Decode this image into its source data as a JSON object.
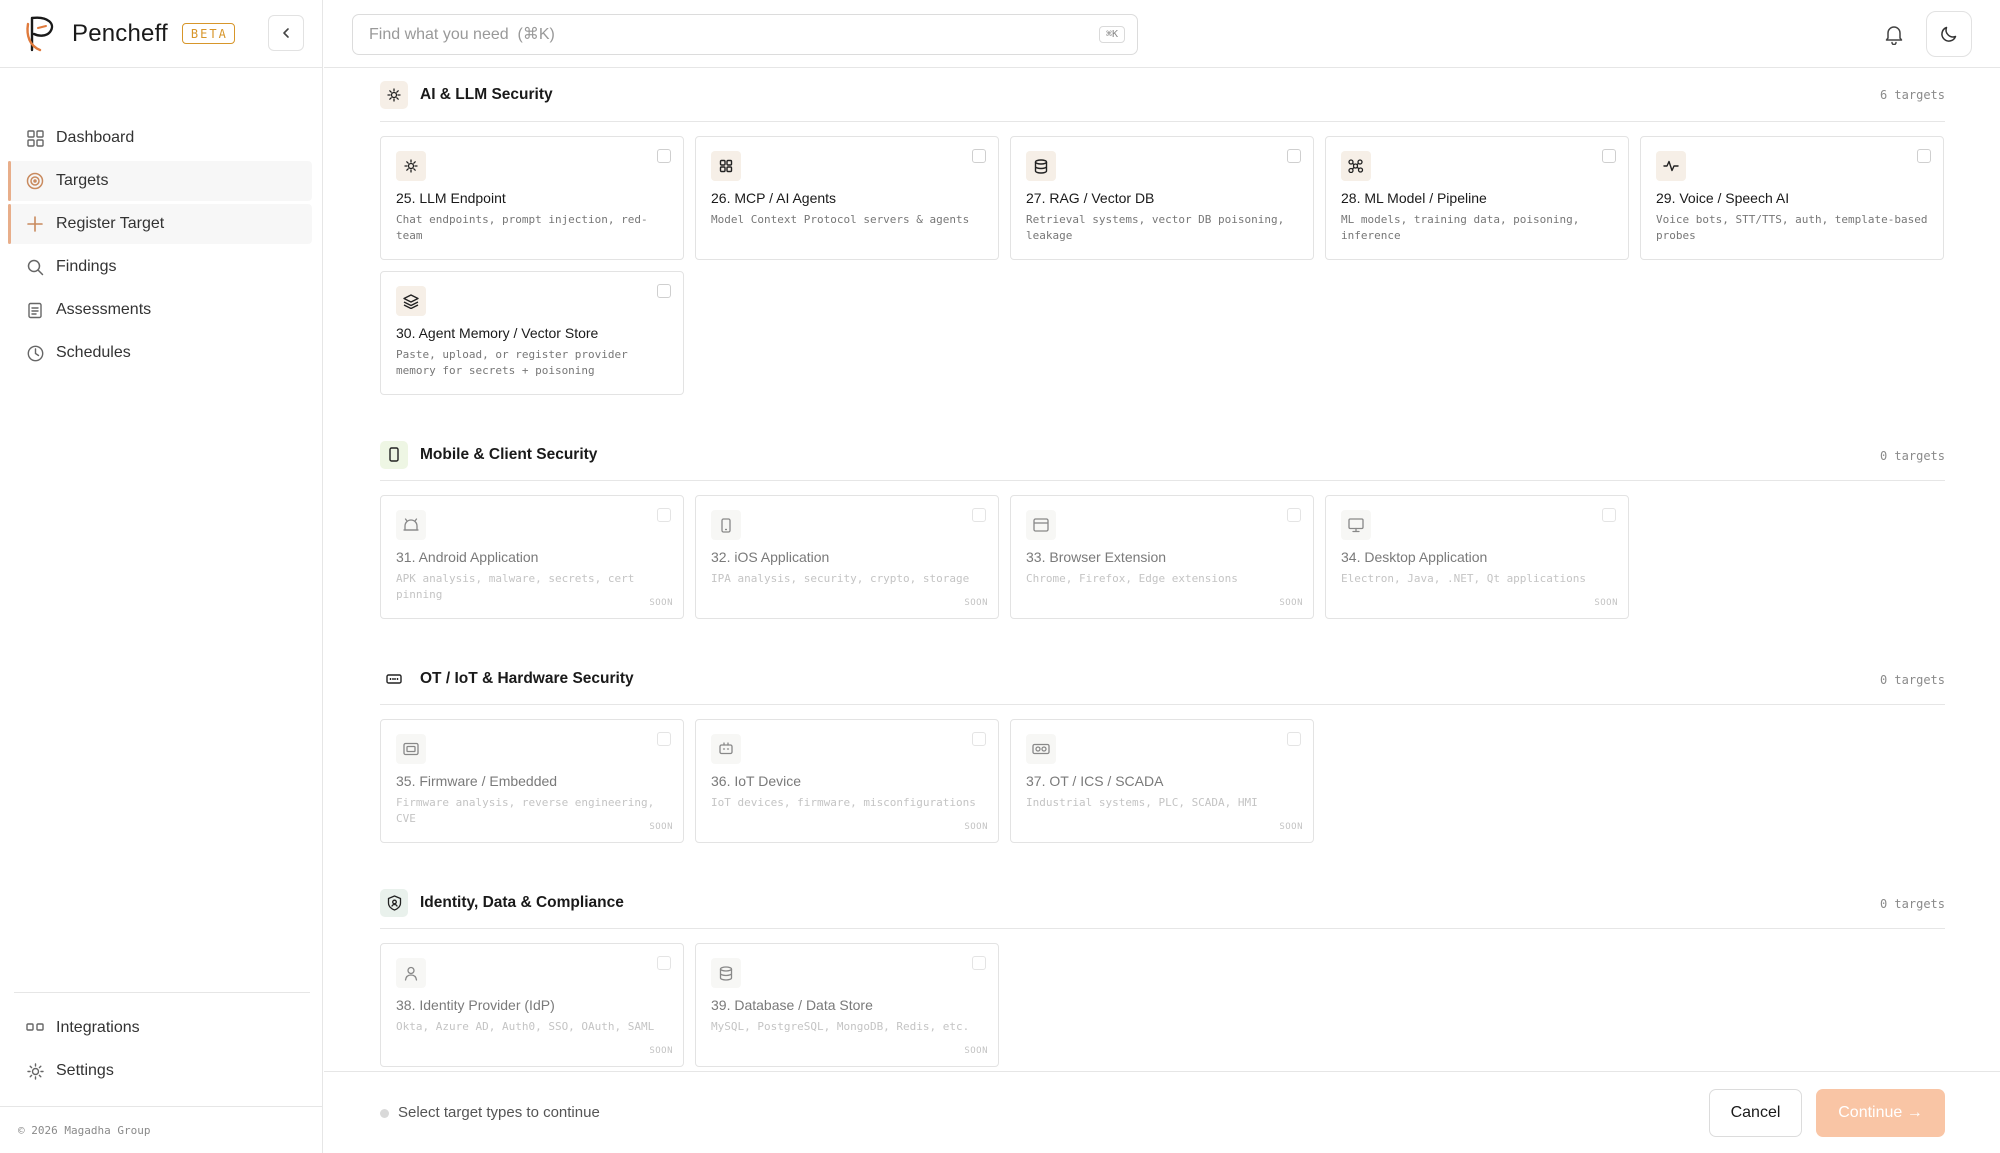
{
  "brand": {
    "name": "Pencheff",
    "badge": "BETA"
  },
  "search": {
    "placeholder": "Find what you need  (⌘K)",
    "shortcut": "⌘K"
  },
  "sidebar": {
    "items": [
      {
        "label": "Dashboard",
        "icon": "grid-icon"
      },
      {
        "label": "Targets",
        "icon": "target-icon"
      },
      {
        "label": "Register Target",
        "icon": "plus-icon"
      },
      {
        "label": "Findings",
        "icon": "search-icon"
      },
      {
        "label": "Assessments",
        "icon": "clipboard-icon"
      },
      {
        "label": "Schedules",
        "icon": "clock-icon"
      }
    ],
    "bottom_items": [
      {
        "label": "Integrations",
        "icon": "integrations-icon"
      },
      {
        "label": "Settings",
        "icon": "gear-icon"
      }
    ],
    "copyright": "© 2026 Magadha Group"
  },
  "sections": {
    "ai": {
      "title": "AI & LLM Security",
      "count": "6 targets",
      "cards": [
        {
          "title": "25. LLM Endpoint",
          "desc": "Chat endpoints, prompt injection, red-team"
        },
        {
          "title": "26. MCP / AI Agents",
          "desc": "Model Context Protocol servers & agents"
        },
        {
          "title": "27. RAG / Vector DB",
          "desc": "Retrieval systems, vector DB poisoning, leakage"
        },
        {
          "title": "28. ML Model / Pipeline",
          "desc": "ML models, training data, poisoning, inference"
        },
        {
          "title": "29. Voice / Speech AI",
          "desc": "Voice bots, STT/TTS, auth, template-based probes"
        },
        {
          "title": "30. Agent Memory / Vector Store",
          "desc": "Paste, upload, or register provider memory for secrets + poisoning"
        }
      ]
    },
    "mobile": {
      "title": "Mobile & Client Security",
      "count": "0 targets",
      "cards": [
        {
          "title": "31. Android Application",
          "desc": "APK analysis, malware, secrets, cert pinning",
          "soon": "SOON"
        },
        {
          "title": "32. iOS Application",
          "desc": "IPA analysis, security, crypto, storage",
          "soon": "SOON"
        },
        {
          "title": "33. Browser Extension",
          "desc": "Chrome, Firefox, Edge extensions",
          "soon": "SOON"
        },
        {
          "title": "34. Desktop Application",
          "desc": "Electron, Java, .NET, Qt applications",
          "soon": "SOON"
        }
      ]
    },
    "ot": {
      "title": "OT / IoT & Hardware Security",
      "count": "0 targets",
      "cards": [
        {
          "title": "35. Firmware / Embedded",
          "desc": "Firmware analysis, reverse engineering, CVE",
          "soon": "SOON"
        },
        {
          "title": "36. IoT Device",
          "desc": "IoT devices, firmware, misconfigurations",
          "soon": "SOON"
        },
        {
          "title": "37. OT / ICS / SCADA",
          "desc": "Industrial systems, PLC, SCADA, HMI",
          "soon": "SOON"
        }
      ]
    },
    "identity": {
      "title": "Identity, Data & Compliance",
      "count": "0 targets",
      "cards": [
        {
          "title": "38. Identity Provider (IdP)",
          "desc": "Okta, Azure AD, Auth0, SSO, OAuth, SAML",
          "soon": "SOON"
        },
        {
          "title": "39. Database / Data Store",
          "desc": "MySQL, PostgreSQL, MongoDB, Redis, etc.",
          "soon": "SOON"
        }
      ]
    }
  },
  "footer": {
    "status": "Select target types to continue",
    "cancel_label": "Cancel",
    "continue_label": "Continue →"
  },
  "colors": {
    "accent": "#f9c5a5",
    "badge": "#d7962a",
    "active_marker": "#e8ae8a"
  }
}
